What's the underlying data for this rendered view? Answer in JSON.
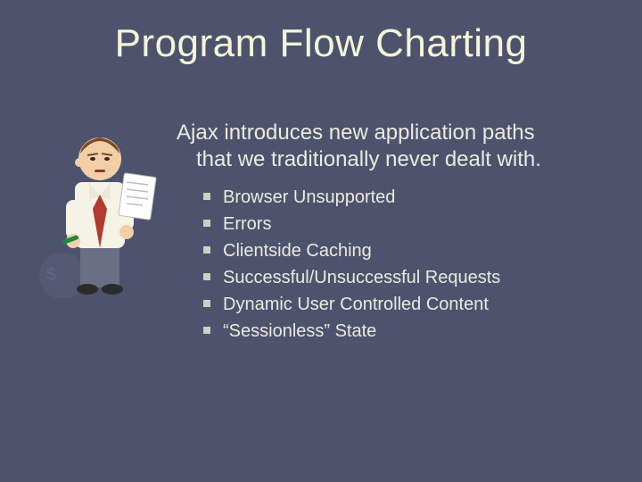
{
  "slide": {
    "title": "Program Flow Charting",
    "intro_line1": "Ajax introduces new application paths",
    "intro_line2": "that we traditionally never dealt with.",
    "bullets": [
      "Browser Unsupported",
      "Errors",
      "Clientside Caching",
      "Successful/Unsuccessful  Requests",
      "Dynamic User Controlled Content",
      "“Sessionless” State"
    ],
    "illustration_name": "cartoon-man-reading-paper"
  }
}
